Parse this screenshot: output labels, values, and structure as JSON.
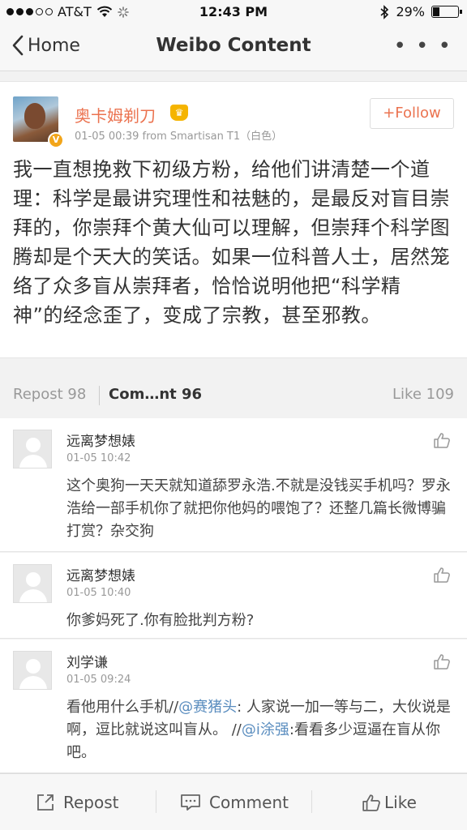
{
  "status": {
    "carrier": "AT&T",
    "time": "12:43 PM",
    "battery": "29%",
    "battery_level": 0.29
  },
  "nav": {
    "back_label": "Home",
    "title": "Weibo Content",
    "more": "• • •"
  },
  "post": {
    "username": "奥卡姆剃刀",
    "meta": "01-05 00:39  from Smartisan T1（白色）",
    "follow_label": "+Follow",
    "text": "我一直想挽救下初级方粉，给他们讲清楚一个道理：科学是最讲究理性和祛魅的，是最反对盲目崇拜的，你崇拜个黄大仙可以理解，但崇拜个科学图腾却是个天大的笑话。如果一位科普人士，居然笼络了众多盲从崇拜者，恰恰说明他把“科学精神”的经念歪了，变成了宗教，甚至邪教。"
  },
  "tabs": {
    "repost": "Repost 98",
    "comment": "Com…nt 96",
    "like": "Like 109"
  },
  "comments": [
    {
      "name": "远离梦想婊",
      "time": "01-05 10:42",
      "text": "这个奥狗一天天就知道舔罗永浩.不就是没钱买手机吗？罗永浩给一部手机你了就把你他妈的喂饱了？还整几篇长微博骗打赏？杂交狗"
    },
    {
      "name": "远离梦想婊",
      "time": "01-05 10:40",
      "text": "你爹妈死了.你有脸批判方粉?"
    },
    {
      "name": "刘学谦",
      "time": "01-05 09:24",
      "text_a": "看他用什么手机//",
      "mention_a": "@赛猪头",
      "text_b": ": 人家说一加一等与二，大伙说是啊，逗比就说这叫盲从。 //",
      "mention_b": "@i涂强",
      "text_c": ":看看多少逗逼在盲从你吧。"
    }
  ],
  "toolbar": {
    "repost": "Repost",
    "comment": "Comment",
    "like": "Like"
  }
}
